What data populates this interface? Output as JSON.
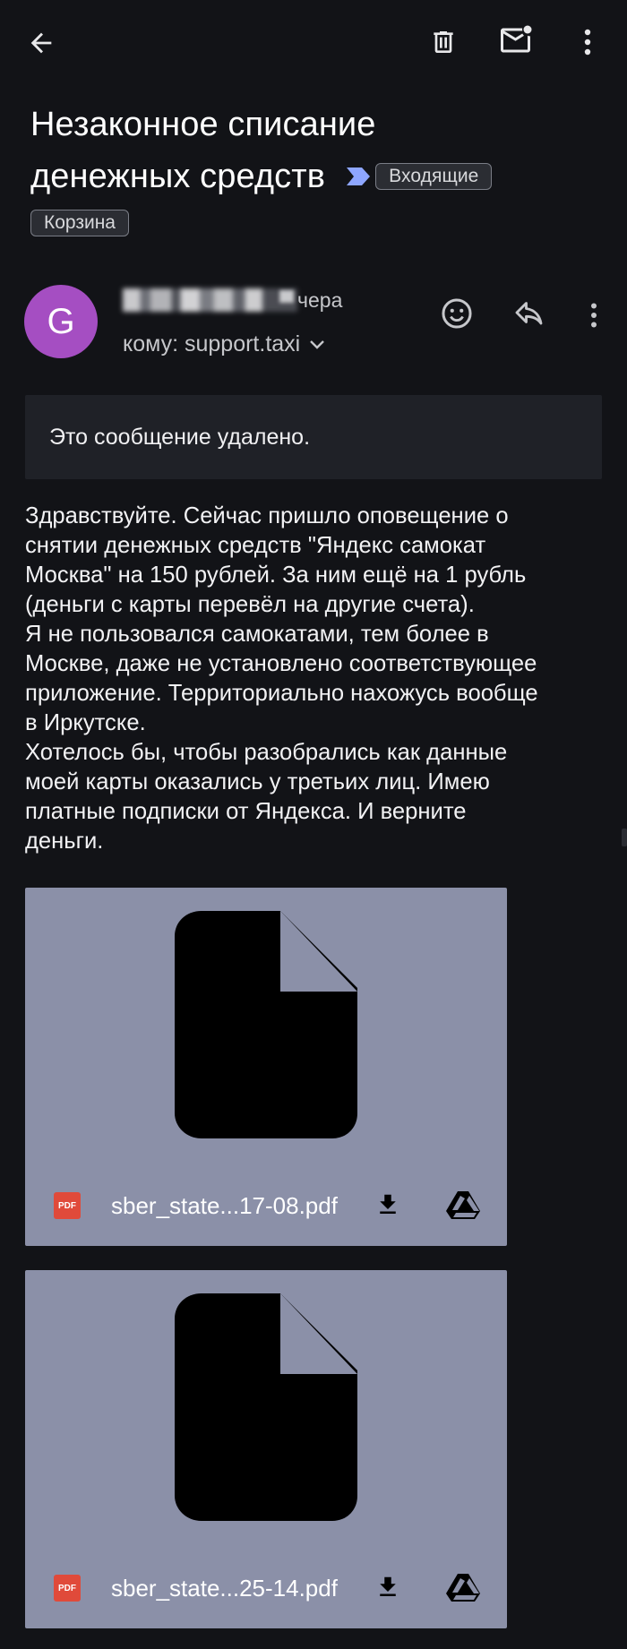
{
  "toolbar": {
    "back_icon": "arrow-back-icon",
    "delete_icon": "trash-icon",
    "mark_unread_icon": "mail-unread-icon",
    "more_icon": "more-vert-icon"
  },
  "subject": {
    "line1": "Незаконное списание",
    "line2": "денежных средств",
    "label_inbox": "Входящие",
    "label_trash": "Корзина",
    "importance_color": "#8ea6ff"
  },
  "message": {
    "avatar_letter": "G",
    "avatar_color": "#a54ec2",
    "date": "чера",
    "recipient": "кому: support.taxi",
    "deleted_notice": "Это сообщение удалено.",
    "body": "Здравствуйте. Сейчас пришло оповещение о\nснятии денежных средств \"Яндекс самокат\nМосква\" на 150 рублей. За ним ещё на 1 рубль\n(деньги с карты перевёл на другие счета).\nЯ не пользовался самокатами, тем более в\nМоскве, даже не установлено соответствующее\nприложение. Территориально нахожусь вообще\nв Иркутске.\nХотелось бы, чтобы разобрались как данные\nмоей карты оказались у третьих лиц. Имею\nплатные подписки от Яндекса. И верните\nденьги."
  },
  "attachments": [
    {
      "pdf_badge": "PDF",
      "filename": "sber_state...17-08.pdf"
    },
    {
      "pdf_badge": "PDF",
      "filename": "sber_state...25-14.pdf"
    }
  ]
}
